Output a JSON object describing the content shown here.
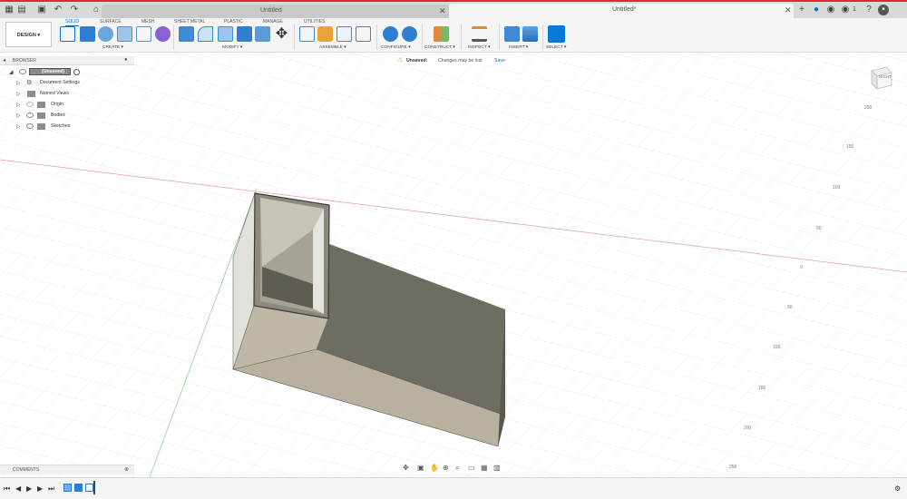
{
  "tabs": {
    "inactive_title": "Untitled",
    "active_title": "Untitled*",
    "notification_count": "1"
  },
  "toolbar": {
    "design_label": "DESIGN ▾",
    "workspace_tabs": [
      "SOLID",
      "SURFACE",
      "MESH",
      "SHEET METAL",
      "PLASTIC",
      "MANAGE",
      "UTILITIES"
    ],
    "groups": [
      "CREATE ▾",
      "MODIFY ▾",
      "ASSEMBLE ▾",
      "CONFIGURE ▾",
      "CONSTRUCT ▾",
      "INSPECT ▾",
      "INSERT ▾",
      "SELECT ▾"
    ]
  },
  "browser": {
    "title": "BROWSER",
    "root": "(Unsaved)",
    "items": [
      "Document Settings",
      "Named Views",
      "Origin",
      "Bodies",
      "Sketches"
    ]
  },
  "banner": {
    "status": "Unsaved:",
    "message": "Changes may be lost",
    "action": "Save"
  },
  "viewcube": {
    "face": "RIGHT"
  },
  "axis_ticks": [
    "250",
    "150",
    "100",
    "50",
    "0",
    "50",
    "100",
    "150",
    "200",
    "250"
  ],
  "comments": {
    "title": "COMMENTS"
  },
  "colors": {
    "accent": "#0a6ec9",
    "brand_bar": "#e32636",
    "body_fill": "#b8b1a0"
  }
}
